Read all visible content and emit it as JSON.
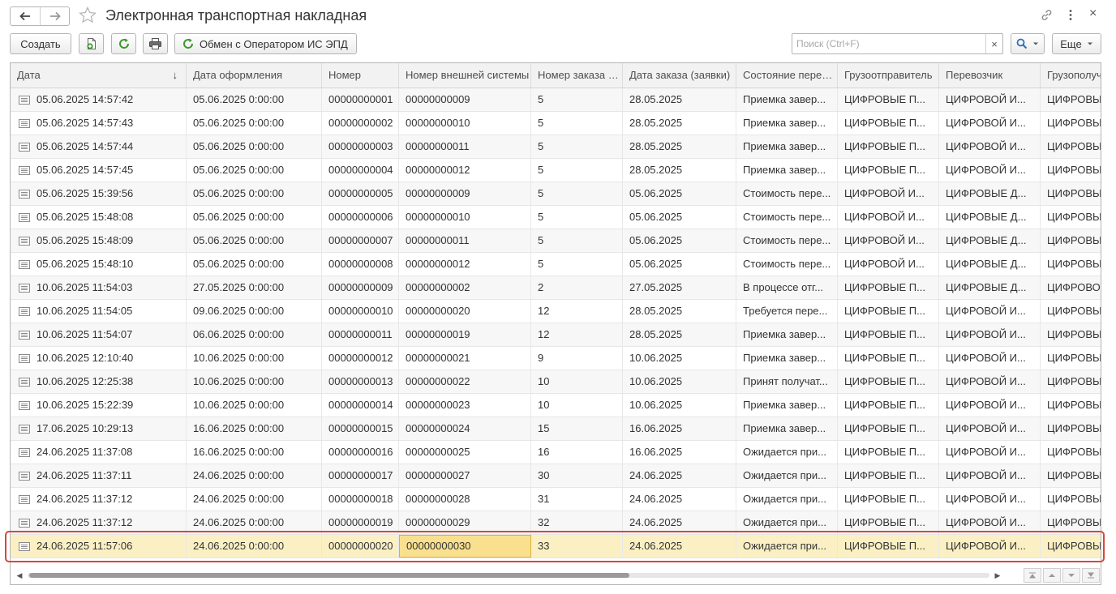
{
  "window": {
    "title": "Электронная транспортная накладная",
    "back_icon": "arrow-left-icon",
    "forward_icon": "arrow-right-icon",
    "favorite_icon": "star-icon",
    "link_icon": "link-icon",
    "more_icon": "vertical-dots-icon",
    "close_label": "×"
  },
  "toolbar": {
    "create_label": "Создать",
    "copy_icon": "add-document-icon",
    "refresh_icon": "refresh-icon",
    "print_icon": "printer-icon",
    "exchange_label": "Обмен с Оператором ИС ЭПД",
    "search_placeholder": "Поиск (Ctrl+F)",
    "search_value": "",
    "clear_label": "×",
    "search_icon": "search-icon",
    "more_label": "Еще"
  },
  "table": {
    "columns": [
      "Дата",
      "Дата оформления",
      "Номер",
      "Номер внешней системы",
      "Номер заказа (заявки)",
      "Дата заказа (заявки)",
      "Состояние перевозки",
      "Грузоотправитель",
      "Перевозчик",
      "Грузополучатель"
    ],
    "sorted_column": "Дата",
    "sort_direction": "↓",
    "rows": [
      [
        "05.06.2025 14:57:42",
        "05.06.2025 0:00:00",
        "00000000001",
        "00000000009",
        "5",
        "28.05.2025",
        "Приемка завер...",
        "ЦИФРОВЫЕ П...",
        "ЦИФРОВОЙ И...",
        "ЦИФРОВЫ"
      ],
      [
        "05.06.2025 14:57:43",
        "05.06.2025 0:00:00",
        "00000000002",
        "00000000010",
        "5",
        "28.05.2025",
        "Приемка завер...",
        "ЦИФРОВЫЕ П...",
        "ЦИФРОВОЙ И...",
        "ЦИФРОВЫ"
      ],
      [
        "05.06.2025 14:57:44",
        "05.06.2025 0:00:00",
        "00000000003",
        "00000000011",
        "5",
        "28.05.2025",
        "Приемка завер...",
        "ЦИФРОВЫЕ П...",
        "ЦИФРОВОЙ И...",
        "ЦИФРОВЫ"
      ],
      [
        "05.06.2025 14:57:45",
        "05.06.2025 0:00:00",
        "00000000004",
        "00000000012",
        "5",
        "28.05.2025",
        "Приемка завер...",
        "ЦИФРОВЫЕ П...",
        "ЦИФРОВОЙ И...",
        "ЦИФРОВЫ"
      ],
      [
        "05.06.2025 15:39:56",
        "05.06.2025 0:00:00",
        "00000000005",
        "00000000009",
        "5",
        "05.06.2025",
        "Стоимость пере...",
        "ЦИФРОВОЙ И...",
        "ЦИФРОВЫЕ Д...",
        "ЦИФРОВЫ"
      ],
      [
        "05.06.2025 15:48:08",
        "05.06.2025 0:00:00",
        "00000000006",
        "00000000010",
        "5",
        "05.06.2025",
        "Стоимость пере...",
        "ЦИФРОВОЙ И...",
        "ЦИФРОВЫЕ Д...",
        "ЦИФРОВЫ"
      ],
      [
        "05.06.2025 15:48:09",
        "05.06.2025 0:00:00",
        "00000000007",
        "00000000011",
        "5",
        "05.06.2025",
        "Стоимость пере...",
        "ЦИФРОВОЙ И...",
        "ЦИФРОВЫЕ Д...",
        "ЦИФРОВЫ"
      ],
      [
        "05.06.2025 15:48:10",
        "05.06.2025 0:00:00",
        "00000000008",
        "00000000012",
        "5",
        "05.06.2025",
        "Стоимость пере...",
        "ЦИФРОВОЙ И...",
        "ЦИФРОВЫЕ Д...",
        "ЦИФРОВЫ"
      ],
      [
        "10.06.2025 11:54:03",
        "27.05.2025 0:00:00",
        "00000000009",
        "00000000002",
        "2",
        "27.05.2025",
        "В процессе отг...",
        "ЦИФРОВЫЕ П...",
        "ЦИФРОВЫЕ Д...",
        "ЦИФРОВО"
      ],
      [
        "10.06.2025 11:54:05",
        "09.06.2025 0:00:00",
        "00000000010",
        "00000000020",
        "12",
        "28.05.2025",
        "Требуется пере...",
        "ЦИФРОВЫЕ П...",
        "ЦИФРОВОЙ И...",
        "ЦИФРОВЫ"
      ],
      [
        "10.06.2025 11:54:07",
        "06.06.2025 0:00:00",
        "00000000011",
        "00000000019",
        "12",
        "28.05.2025",
        "Приемка завер...",
        "ЦИФРОВЫЕ П...",
        "ЦИФРОВОЙ И...",
        "ЦИФРОВЫ"
      ],
      [
        "10.06.2025 12:10:40",
        "10.06.2025 0:00:00",
        "00000000012",
        "00000000021",
        "9",
        "10.06.2025",
        "Приемка завер...",
        "ЦИФРОВЫЕ П...",
        "ЦИФРОВОЙ И...",
        "ЦИФРОВЫ"
      ],
      [
        "10.06.2025 12:25:38",
        "10.06.2025 0:00:00",
        "00000000013",
        "00000000022",
        "10",
        "10.06.2025",
        "Принят получат...",
        "ЦИФРОВЫЕ П...",
        "ЦИФРОВОЙ И...",
        "ЦИФРОВЫ"
      ],
      [
        "10.06.2025 15:22:39",
        "10.06.2025 0:00:00",
        "00000000014",
        "00000000023",
        "10",
        "10.06.2025",
        "Приемка завер...",
        "ЦИФРОВЫЕ П...",
        "ЦИФРОВОЙ И...",
        "ЦИФРОВЫ"
      ],
      [
        "17.06.2025 10:29:13",
        "16.06.2025 0:00:00",
        "00000000015",
        "00000000024",
        "15",
        "16.06.2025",
        "Приемка завер...",
        "ЦИФРОВЫЕ П...",
        "ЦИФРОВОЙ И...",
        "ЦИФРОВЫ"
      ],
      [
        "24.06.2025 11:37:08",
        "16.06.2025 0:00:00",
        "00000000016",
        "00000000025",
        "16",
        "16.06.2025",
        "Ожидается при...",
        "ЦИФРОВЫЕ П...",
        "ЦИФРОВОЙ И...",
        "ЦИФРОВЫ"
      ],
      [
        "24.06.2025 11:37:11",
        "24.06.2025 0:00:00",
        "00000000017",
        "00000000027",
        "30",
        "24.06.2025",
        "Ожидается при...",
        "ЦИФРОВЫЕ П...",
        "ЦИФРОВОЙ И...",
        "ЦИФРОВЫ"
      ],
      [
        "24.06.2025 11:37:12",
        "24.06.2025 0:00:00",
        "00000000018",
        "00000000028",
        "31",
        "24.06.2025",
        "Ожидается при...",
        "ЦИФРОВЫЕ П...",
        "ЦИФРОВОЙ И...",
        "ЦИФРОВЫ"
      ],
      [
        "24.06.2025 11:37:12",
        "24.06.2025 0:00:00",
        "00000000019",
        "00000000029",
        "32",
        "24.06.2025",
        "Ожидается при...",
        "ЦИФРОВЫЕ П...",
        "ЦИФРОВОЙ И...",
        "ЦИФРОВЫ"
      ],
      [
        "24.06.2025 11:57:06",
        "24.06.2025 0:00:00",
        "00000000020",
        "00000000030",
        "33",
        "24.06.2025",
        "Ожидается при...",
        "ЦИФРОВЫЕ П...",
        "ЦИФРОВОЙ И...",
        "ЦИФРОВЫ"
      ]
    ],
    "row_icon": "document-list-icon",
    "selected_row": 20,
    "focused_column": "Номер внешней системы"
  },
  "footer": {
    "scroll_left_icon": "triangle-left-icon",
    "scroll_right_icon": "triangle-right-icon",
    "nav_icons": [
      "go-first-icon",
      "page-up-icon",
      "page-down-icon",
      "go-last-icon"
    ]
  },
  "colors": {
    "selected_row": "#fbf0c4",
    "focused_cell": "#f9e08e",
    "highlight_outline": "#d9463e",
    "refresh_green": "#3a9a2a"
  }
}
